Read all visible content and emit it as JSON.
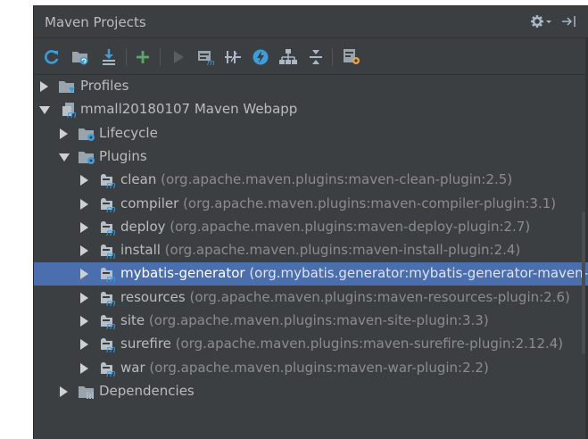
{
  "panel": {
    "title": "Maven Projects"
  },
  "toolbar": {
    "buttons": [
      {
        "name": "reimport-icon",
        "glyph": "refresh"
      },
      {
        "name": "generate-sources-icon",
        "glyph": "folder-refresh"
      },
      {
        "name": "download-icon",
        "glyph": "download"
      },
      {
        "name": "add-maven-project-icon",
        "glyph": "plus"
      },
      {
        "name": "run-icon",
        "glyph": "play"
      },
      {
        "name": "run-maven-build-icon",
        "glyph": "m-run"
      },
      {
        "name": "toggle-offline-icon",
        "glyph": "offline"
      },
      {
        "name": "skip-tests-icon",
        "glyph": "lightning"
      },
      {
        "name": "show-dependencies-icon",
        "glyph": "tree"
      },
      {
        "name": "collapse-all-icon",
        "glyph": "collapse"
      },
      {
        "name": "maven-settings-icon",
        "glyph": "settings"
      }
    ]
  },
  "tree": {
    "profiles": "Profiles",
    "project": "mmall20180107 Maven Webapp",
    "lifecycle": "Lifecycle",
    "plugins": "Plugins",
    "dependencies": "Dependencies",
    "plugin_items": [
      {
        "name": "clean",
        "coords": "(org.apache.maven.plugins:maven-clean-plugin:2.5)"
      },
      {
        "name": "compiler",
        "coords": "(org.apache.maven.plugins:maven-compiler-plugin:3.1)"
      },
      {
        "name": "deploy",
        "coords": "(org.apache.maven.plugins:maven-deploy-plugin:2.7)"
      },
      {
        "name": "install",
        "coords": "(org.apache.maven.plugins:maven-install-plugin:2.4)"
      },
      {
        "name": "mybatis-generator",
        "coords": "(org.mybatis.generator:mybatis-generator-maven-pl"
      },
      {
        "name": "resources",
        "coords": "(org.apache.maven.plugins:maven-resources-plugin:2.6)"
      },
      {
        "name": "site",
        "coords": "(org.apache.maven.plugins:maven-site-plugin:3.3)"
      },
      {
        "name": "surefire",
        "coords": "(org.apache.maven.plugins:maven-surefire-plugin:2.12.4)"
      },
      {
        "name": "war",
        "coords": "(org.apache.maven.plugins:maven-war-plugin:2.2)"
      }
    ],
    "selected_plugin": "mybatis-generator"
  },
  "colors": {
    "panel_bg": "#3c3f41",
    "selection": "#4b6eaf",
    "text": "#bbbbbb",
    "secondary_text": "#8c8c8c"
  }
}
